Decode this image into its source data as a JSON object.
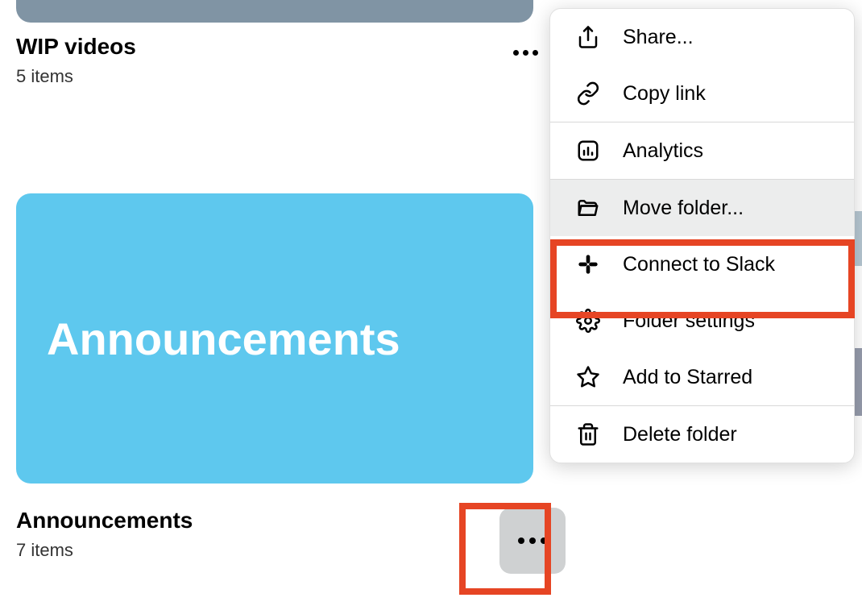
{
  "folders": [
    {
      "title": "WIP videos",
      "subtitle": "5 items"
    },
    {
      "title": "Announcements",
      "subtitle": "7 items",
      "card_label": "Announcements"
    }
  ],
  "context_menu": {
    "share": "Share...",
    "copy_link": "Copy link",
    "analytics": "Analytics",
    "move_folder": "Move folder...",
    "connect_slack": "Connect to Slack",
    "folder_settings": "Folder settings",
    "add_starred": "Add to Starred",
    "delete_folder": "Delete folder"
  }
}
